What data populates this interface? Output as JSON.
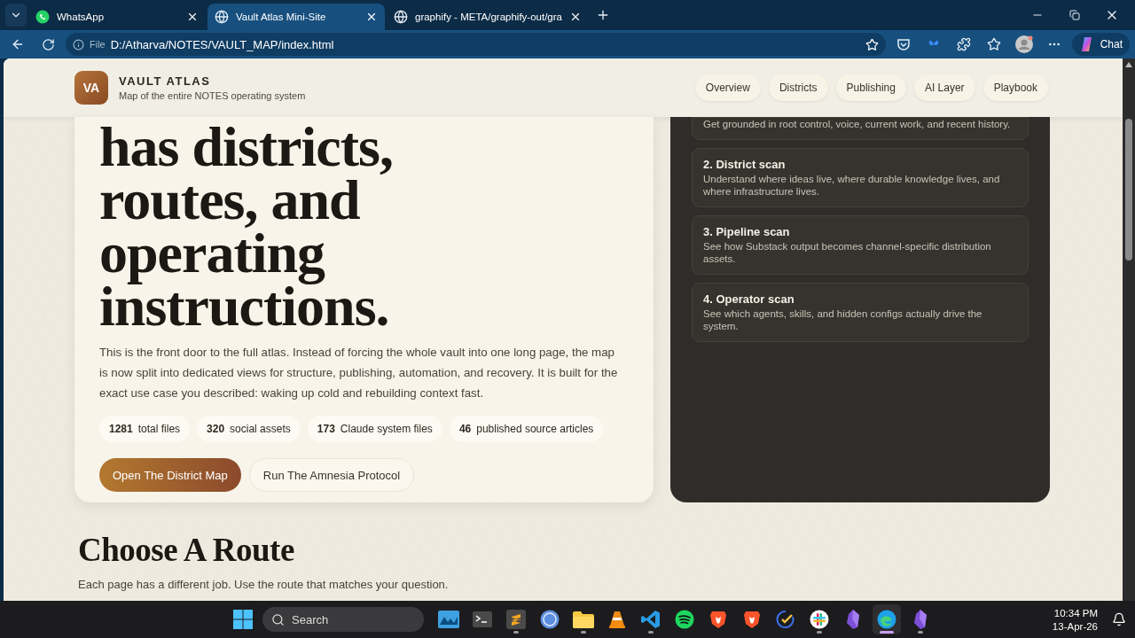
{
  "browser": {
    "tabs": [
      {
        "title": "WhatsApp",
        "kind": "whatsapp",
        "selected": false
      },
      {
        "title": "Vault Atlas Mini-Site",
        "kind": "globe",
        "selected": true
      },
      {
        "title": "graphify - META/graphify-out/gra",
        "kind": "globe",
        "selected": false
      }
    ],
    "address": {
      "scheme": "File",
      "url": "D:/Atharva/NOTES/VAULT_MAP/index.html"
    },
    "chat_label": "Chat"
  },
  "site": {
    "logo": "VA",
    "title": "VAULT ATLAS",
    "subtitle": "Map of the entire NOTES operating system",
    "nav": [
      "Overview",
      "Districts",
      "Publishing",
      "AI Layer",
      "Playbook"
    ]
  },
  "hero": {
    "headline": "has districts, routes, and operating instructions.",
    "intro": "This is the front door to the full atlas. Instead of forcing the whole vault into one long page, the map is now split into dedicated views for structure, publishing, automation, and recovery. It is built for the exact use case you described: waking up cold and rebuilding context fast.",
    "stats": [
      {
        "value": "1281",
        "label": "total files"
      },
      {
        "value": "320",
        "label": "social assets"
      },
      {
        "value": "173",
        "label": "Claude system files"
      },
      {
        "value": "46",
        "label": "published source articles"
      }
    ],
    "buttons": [
      {
        "label": "Open The District Map",
        "kind": "primary"
      },
      {
        "label": "Run The Amnesia Protocol",
        "kind": "secondary"
      }
    ]
  },
  "scans": [
    {
      "description": "Get grounded in root control, voice, current work, and recent history."
    },
    {
      "title": "2. District scan",
      "description": "Understand where ideas live, where durable knowledge lives, and where infrastructure lives."
    },
    {
      "title": "3. Pipeline scan",
      "description": "See how Substack output becomes channel-specific distribution assets."
    },
    {
      "title": "4. Operator scan",
      "description": "See which agents, skills, and hidden configs actually drive the system."
    }
  ],
  "routes": {
    "heading": "Choose A Route",
    "text": "Each page has a different job. Use the route that matches your question."
  },
  "taskbar": {
    "search_placeholder": "Search",
    "apps": [
      {
        "kind": "monitor",
        "running": false,
        "selected": false
      },
      {
        "kind": "terminal",
        "running": false,
        "selected": false
      },
      {
        "kind": "sublime",
        "running": true,
        "selected": false
      },
      {
        "kind": "torrent",
        "running": false,
        "selected": false
      },
      {
        "kind": "folder",
        "running": true,
        "selected": false
      },
      {
        "kind": "vlc",
        "running": false,
        "selected": false
      },
      {
        "kind": "vscode",
        "running": true,
        "selected": false
      },
      {
        "kind": "spotify",
        "running": false,
        "selected": false
      },
      {
        "kind": "brave",
        "running": false,
        "selected": false
      },
      {
        "kind": "brave",
        "running": false,
        "selected": false
      },
      {
        "kind": "todo",
        "running": false,
        "selected": false
      },
      {
        "kind": "slack",
        "running": true,
        "selected": false
      },
      {
        "kind": "obsidian",
        "running": false,
        "selected": false
      },
      {
        "kind": "edge",
        "running": true,
        "selected": true
      },
      {
        "kind": "obsidian",
        "running": true,
        "selected": false
      }
    ],
    "time": "10:34 PM",
    "date": "13-Apr-26"
  }
}
